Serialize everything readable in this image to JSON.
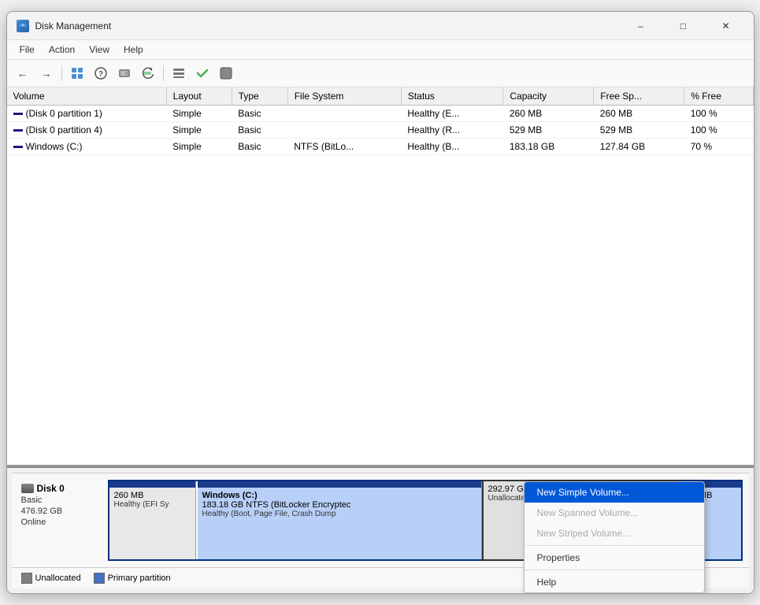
{
  "window": {
    "title": "Disk Management",
    "icon": "disk-icon"
  },
  "title_controls": {
    "minimize": "–",
    "maximize": "□",
    "close": "✕"
  },
  "menu": {
    "items": [
      "File",
      "Action",
      "View",
      "Help"
    ]
  },
  "toolbar": {
    "buttons": [
      "◀",
      "▶",
      "⊞",
      "?",
      "⊟",
      "⊠",
      "⊡",
      "📋",
      "✔",
      "⬛"
    ]
  },
  "table": {
    "columns": [
      "Volume",
      "Layout",
      "Type",
      "File System",
      "Status",
      "Capacity",
      "Free Sp...",
      "% Free"
    ],
    "rows": [
      {
        "volume": "(Disk 0 partition 1)",
        "layout": "Simple",
        "type": "Basic",
        "filesystem": "",
        "status": "Healthy (E...",
        "capacity": "260 MB",
        "free": "260 MB",
        "pct_free": "100 %"
      },
      {
        "volume": "(Disk 0 partition 4)",
        "layout": "Simple",
        "type": "Basic",
        "filesystem": "",
        "status": "Healthy (R...",
        "capacity": "529 MB",
        "free": "529 MB",
        "pct_free": "100 %"
      },
      {
        "volume": "Windows (C:)",
        "layout": "Simple",
        "type": "Basic",
        "filesystem": "NTFS (BitLo...",
        "status": "Healthy (B...",
        "capacity": "183.18 GB",
        "free": "127.84 GB",
        "pct_free": "70 %"
      }
    ]
  },
  "disk": {
    "name": "Disk 0",
    "type": "Basic",
    "size": "476.92 GB",
    "status": "Online",
    "partitions": [
      {
        "id": "efi",
        "size": "260 MB",
        "detail": "Healthy (EFI Sy"
      },
      {
        "id": "windows",
        "name": "Windows  (C:)",
        "size_gb": "183.18 GB NTFS (BitLocker Encryptec",
        "detail": "Healthy (Boot, Page File, Crash Dump"
      },
      {
        "id": "unallocated",
        "size": "292.97 GB",
        "label": "Unallocated"
      },
      {
        "id": "recovery",
        "size": "529 MB",
        "detail": ""
      }
    ]
  },
  "context_menu": {
    "items": [
      {
        "label": "New Simple Volume...",
        "active": true,
        "disabled": false
      },
      {
        "label": "New Spanned Volume...",
        "active": false,
        "disabled": true
      },
      {
        "label": "New Striped Volume...",
        "active": false,
        "disabled": true
      },
      {
        "separator": true
      },
      {
        "label": "Properties",
        "active": false,
        "disabled": false
      },
      {
        "separator": false
      },
      {
        "label": "Help",
        "active": false,
        "disabled": false
      }
    ]
  },
  "legend": {
    "items": [
      {
        "type": "unallocated",
        "label": "Unallocated"
      },
      {
        "type": "primary",
        "label": "Primary partition"
      }
    ]
  }
}
